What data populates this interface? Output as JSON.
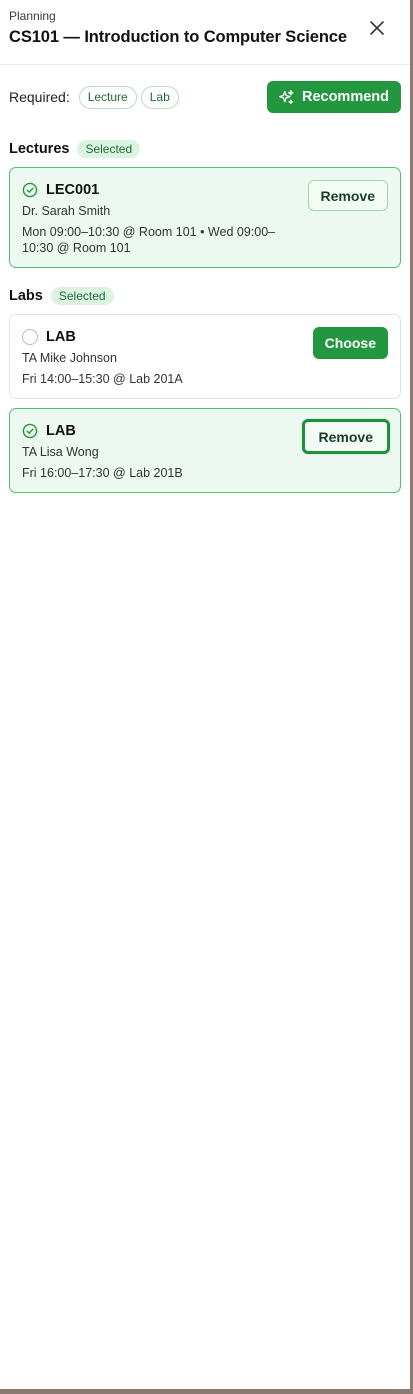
{
  "header": {
    "eyebrow": "Planning",
    "title": "CS101 — Introduction to Computer Science",
    "close_icon": "close-icon"
  },
  "requirements": {
    "label": "Required:",
    "chips": [
      "Lecture",
      "Lab"
    ],
    "recommend_label": "Recommend",
    "recommend_icon": "sparkles-icon"
  },
  "lectures": {
    "title": "Lectures",
    "badge": "Selected",
    "items": [
      {
        "code": "LEC001",
        "instructor": "Dr. Sarah Smith",
        "schedule": "Mon 09:00–10:30 @ Room 101 • Wed 09:00–10:30 @ Room 101",
        "selected": true,
        "action": "Remove"
      }
    ]
  },
  "labs": {
    "title": "Labs",
    "badge": "Selected",
    "items": [
      {
        "code": "LAB",
        "instructor": "TA Mike Johnson",
        "schedule": "Fri 14:00–15:30 @ Lab 201A",
        "selected": false,
        "action": "Choose"
      },
      {
        "code": "LAB",
        "instructor": "TA Lisa Wong",
        "schedule": "Fri 16:00–17:30 @ Lab 201B",
        "selected": true,
        "action": "Remove"
      }
    ]
  },
  "colors": {
    "accent": "#22973f",
    "selected_bg": "#edf9f0",
    "selected_border": "#4cc172",
    "badge_bg": "#dcf3e2"
  }
}
